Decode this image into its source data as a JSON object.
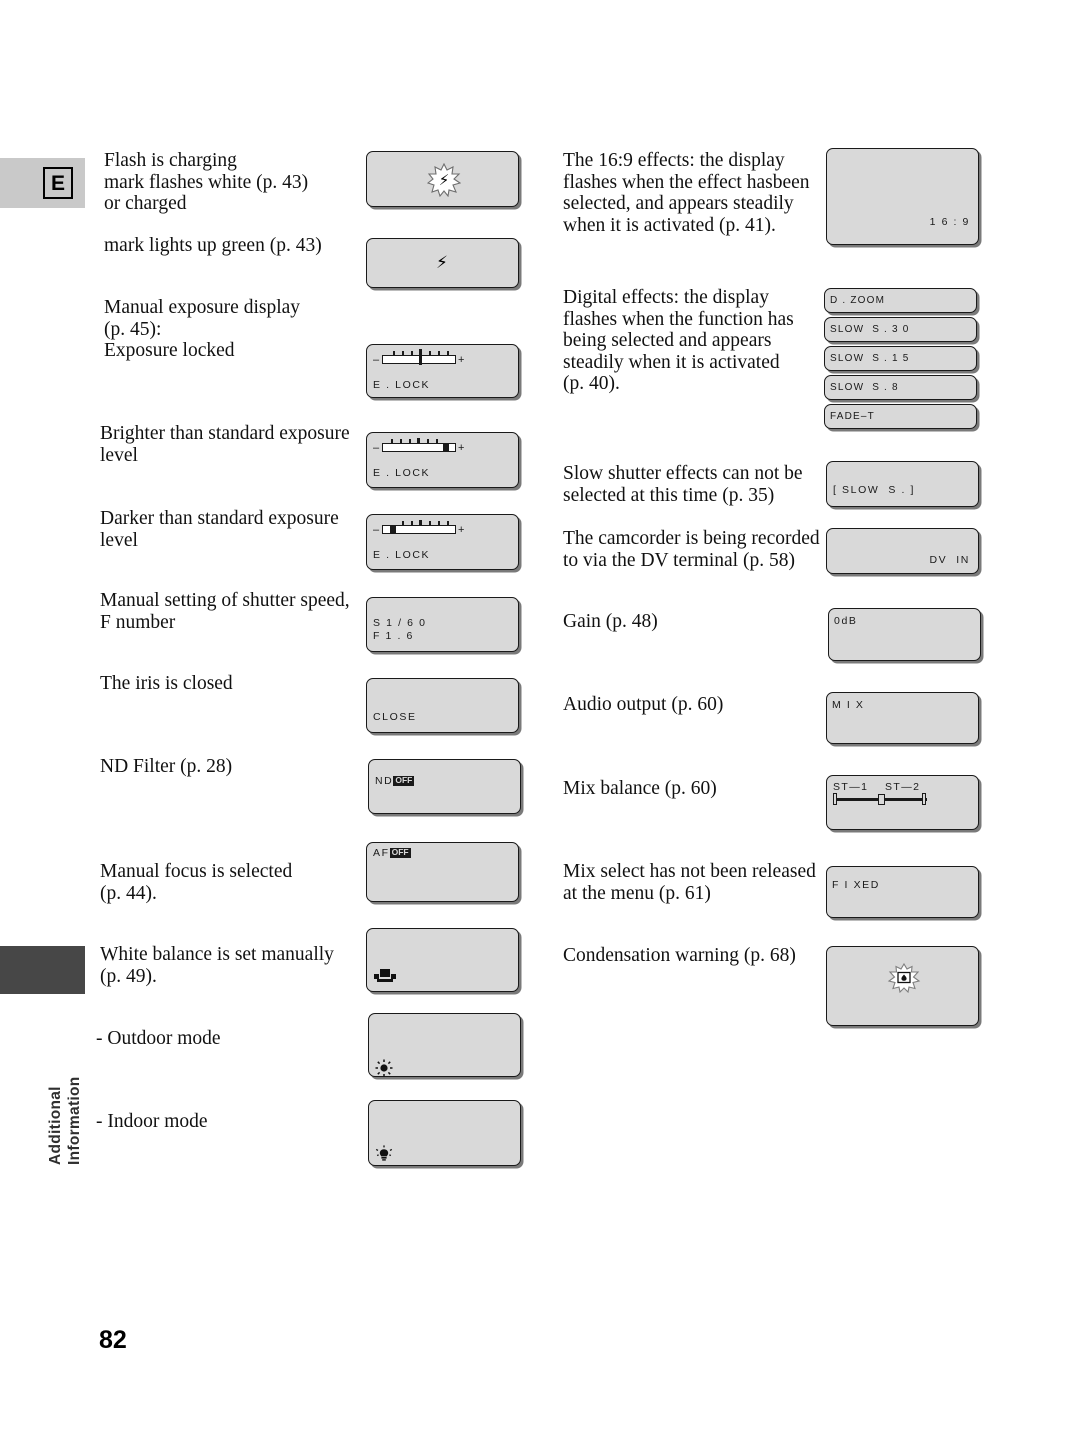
{
  "page": {
    "number": "82",
    "side_tab_letter": "E",
    "side_tab_vertical_label": "Additional\nInformation"
  },
  "left_column": [
    {
      "id": "flash-charging",
      "text": "Flash is charging\n  mark flashes white (p. 43)\nor charged",
      "display": {
        "type": "flash-burst",
        "icon": "flash-bolt-flashing-icon"
      }
    },
    {
      "id": "flash-charged",
      "text": "  mark lights up green (p. 43)",
      "display": {
        "type": "flash-steady",
        "icon": "flash-bolt-icon"
      }
    },
    {
      "id": "manual-exposure",
      "text": "Manual exposure display\n(p. 45):\nExposure locked",
      "display": {
        "type": "exposure-meter",
        "position": "center",
        "label": "E . LOCK"
      }
    },
    {
      "id": "brighter-exposure",
      "text": "Brighter than standard exposure\nlevel",
      "display": {
        "type": "exposure-meter",
        "position": "right",
        "label": "E . LOCK"
      }
    },
    {
      "id": "darker-exposure",
      "text": "Darker than standard exposure\nlevel",
      "display": {
        "type": "exposure-meter",
        "position": "left",
        "label": "E . LOCK"
      }
    },
    {
      "id": "manual-shutter",
      "text": "Manual setting of shutter speed,\nF number",
      "display": {
        "type": "text-lines",
        "line1": "S 1 / 6 0",
        "line2": "F 1 . 6"
      }
    },
    {
      "id": "iris-closed",
      "text": "The iris is closed",
      "display": {
        "type": "text-lines",
        "line1": "CLOSE"
      }
    },
    {
      "id": "nd-filter",
      "text": "ND Filter (p. 28)",
      "display": {
        "type": "badge",
        "prefix": "ND",
        "badge": "OFF"
      }
    },
    {
      "id": "manual-focus",
      "text": "Manual focus is selected\n(p. 44).",
      "display": {
        "type": "badge",
        "prefix": "AF",
        "badge": "OFF"
      }
    },
    {
      "id": "white-balance-manual",
      "text": "White balance is set manually\n(p. 49).",
      "display": {
        "type": "icon",
        "icon": "white-balance-custom-icon"
      }
    },
    {
      "id": "outdoor-mode",
      "text": "- Outdoor mode",
      "display": {
        "type": "icon",
        "icon": "sun-outdoor-icon"
      }
    },
    {
      "id": "indoor-mode",
      "text": "- Indoor mode",
      "display": {
        "type": "icon",
        "icon": "bulb-indoor-icon"
      }
    }
  ],
  "right_column": [
    {
      "id": "wide-16-9",
      "text": "The 16:9 effects: the display\nflashes when the effect hasbeen\nselected, and appears steadily\nwhen it is activated (p. 41).",
      "display": {
        "type": "text-corner",
        "value": "1 6 : 9"
      }
    },
    {
      "id": "digital-effects",
      "text": "Digital effects: the display\nflashes when the function has\nbeing selected and appears\nsteadily when it is activated\n(p. 40).",
      "display": {
        "type": "stack",
        "items": [
          "D . ZOOM",
          "SLOW  S . 3 0",
          "SLOW  S . 1 5",
          "SLOW  S . 8",
          "FADE–T"
        ]
      }
    },
    {
      "id": "slow-shutter-unavailable",
      "text": "Slow shutter effects can not be\nselected at this time (p. 35)",
      "display": {
        "type": "text-lines",
        "line1": "[ SLOW  S . ]"
      }
    },
    {
      "id": "dv-in",
      "text": "The camcorder is being recorded\nto via the DV terminal (p. 58)",
      "display": {
        "type": "text-corner",
        "value": "DV  IN"
      }
    },
    {
      "id": "gain",
      "text": "Gain (p. 48)",
      "display": {
        "type": "text-lines",
        "line1": "0dB"
      }
    },
    {
      "id": "audio-output",
      "text": "Audio output (p. 60)",
      "display": {
        "type": "text-lines",
        "line1": "M I X"
      }
    },
    {
      "id": "mix-balance",
      "text": "Mix balance (p. 60)",
      "display": {
        "type": "mix-balance",
        "label_left": "ST—1",
        "label_right": "ST—2"
      }
    },
    {
      "id": "mix-select-fixed",
      "text": "Mix select has not been released\nat the menu (p. 61)",
      "display": {
        "type": "text-lines",
        "line1": "F I XED"
      }
    },
    {
      "id": "condensation-warning",
      "text": "Condensation warning (p. 68)",
      "display": {
        "type": "icon",
        "icon": "condensation-drop-flashing-icon"
      }
    }
  ]
}
